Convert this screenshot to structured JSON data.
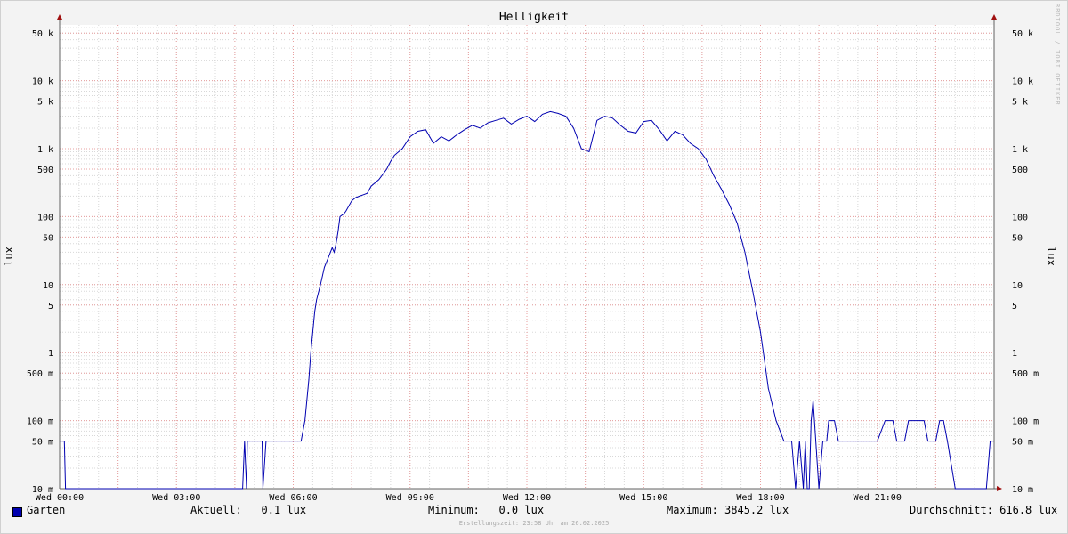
{
  "watermark": "RRDTOOL / TOBI OETIKER",
  "footer": "Erstellungszeit: 23:58 Uhr am 26.02.2025",
  "legend": {
    "series_name": "Garten",
    "current": "Aktuell:   0.1 lux",
    "minimum": "Minimum:   0.0 lux",
    "maximum": "Maximum: 3845.2 lux",
    "average": "Durchschnitt: 616.8 lux"
  },
  "colors": {
    "line": "#0000b0",
    "major_grid": "#e8a0a0",
    "minor_grid": "#d8d8d8",
    "arrow": "#a01010"
  },
  "chart_data": {
    "type": "line",
    "title": "Helligkeit",
    "ylabel": "lux",
    "ylabel_right": "lux",
    "yscale": "log",
    "ylim": [
      10,
      70000
    ],
    "xlim": [
      0,
      24
    ],
    "x_ticks": [
      {
        "v": 0,
        "label": "Wed 00:00"
      },
      {
        "v": 3,
        "label": "Wed 03:00"
      },
      {
        "v": 6,
        "label": "Wed 06:00"
      },
      {
        "v": 9,
        "label": "Wed 09:00"
      },
      {
        "v": 12,
        "label": "Wed 12:00"
      },
      {
        "v": 15,
        "label": "Wed 15:00"
      },
      {
        "v": 18,
        "label": "Wed 18:00"
      },
      {
        "v": 21,
        "label": "Wed 21:00"
      }
    ],
    "y_ticks": [
      {
        "v": 50000,
        "label": "50 k"
      },
      {
        "v": 10000,
        "label": "10 k"
      },
      {
        "v": 5000,
        "label": "5 k"
      },
      {
        "v": 1000,
        "label": "1 k"
      },
      {
        "v": 500,
        "label": "500"
      },
      {
        "v": 100,
        "label": "100"
      },
      {
        "v": 50,
        "label": "50"
      },
      {
        "v": 10,
        "label": "10"
      },
      {
        "v": 5,
        "label": "5"
      },
      {
        "v": 1,
        "label": "1"
      },
      {
        "v": 0.5,
        "label": "500 m"
      },
      {
        "v": 0.1,
        "label": "100 m"
      },
      {
        "v": 0.05,
        "label": "50 m"
      },
      {
        "v": 0.01,
        "label": "10 m"
      }
    ],
    "series": [
      {
        "name": "Garten",
        "x": [
          0.0,
          0.12,
          0.15,
          0.17,
          1.0,
          2.0,
          3.0,
          4.7,
          4.75,
          4.8,
          4.82,
          4.85,
          5.0,
          5.2,
          5.22,
          5.3,
          5.33,
          5.5,
          5.7,
          6.0,
          6.2,
          6.3,
          6.35,
          6.4,
          6.45,
          6.5,
          6.55,
          6.6,
          6.7,
          6.8,
          6.9,
          7.0,
          7.05,
          7.1,
          7.15,
          7.2,
          7.3,
          7.35,
          7.5,
          7.6,
          7.7,
          7.8,
          7.9,
          8.0,
          8.2,
          8.4,
          8.5,
          8.6,
          8.8,
          9.0,
          9.2,
          9.4,
          9.6,
          9.8,
          10.0,
          10.2,
          10.4,
          10.6,
          10.8,
          11.0,
          11.2,
          11.4,
          11.6,
          11.8,
          12.0,
          12.2,
          12.4,
          12.6,
          12.8,
          13.0,
          13.2,
          13.4,
          13.6,
          13.8,
          14.0,
          14.2,
          14.4,
          14.6,
          14.8,
          15.0,
          15.2,
          15.4,
          15.6,
          15.8,
          16.0,
          16.2,
          16.4,
          16.6,
          16.8,
          17.0,
          17.2,
          17.4,
          17.6,
          17.8,
          18.0,
          18.2,
          18.4,
          18.6,
          18.8,
          18.9,
          19.0,
          19.1,
          19.15,
          19.2,
          19.25,
          19.3,
          19.35,
          19.5,
          19.6,
          19.7,
          19.75,
          19.8,
          19.9,
          20.0,
          20.1,
          20.2,
          20.3,
          20.4,
          20.5,
          20.6,
          20.8,
          21.0,
          21.2,
          21.4,
          21.5,
          21.6,
          21.7,
          21.8,
          22.0,
          22.2,
          22.3,
          22.5,
          22.6,
          22.7,
          22.8,
          23.0,
          23.5,
          23.8,
          23.9,
          24.0
        ],
        "y": [
          0.05,
          0.05,
          0.01,
          0.01,
          0.01,
          0.01,
          0.01,
          0.01,
          0.05,
          0.01,
          0.05,
          0.05,
          0.05,
          0.05,
          0.01,
          0.05,
          0.05,
          0.05,
          0.05,
          0.05,
          0.05,
          0.1,
          0.2,
          0.4,
          1.0,
          2.0,
          4.0,
          6.0,
          10,
          18,
          25,
          35,
          30,
          40,
          60,
          100,
          110,
          120,
          170,
          190,
          200,
          210,
          220,
          280,
          350,
          500,
          650,
          800,
          1000,
          1500,
          1800,
          1900,
          1200,
          1500,
          1300,
          1600,
          1900,
          2200,
          2000,
          2400,
          2600,
          2800,
          2300,
          2700,
          3000,
          2500,
          3200,
          3500,
          3300,
          3000,
          2000,
          1000,
          900,
          2600,
          3000,
          2800,
          2200,
          1800,
          1700,
          2500,
          2600,
          1900,
          1300,
          1800,
          1600,
          1200,
          1000,
          700,
          400,
          250,
          150,
          80,
          30,
          8,
          2,
          0.3,
          0.1,
          0.05,
          0.05,
          0.01,
          0.05,
          0.01,
          0.05,
          0.01,
          0.01,
          0.1,
          0.2,
          0.01,
          0.05,
          0.05,
          0.1,
          0.1,
          0.1,
          0.05,
          0.05,
          0.05,
          0.05,
          0.05,
          0.05,
          0.05,
          0.05,
          0.05,
          0.1,
          0.1,
          0.05,
          0.05,
          0.05,
          0.1,
          0.1,
          0.1,
          0.05,
          0.05,
          0.1,
          0.1,
          0.05,
          0.01,
          0.01,
          0.01,
          0.05,
          0.05
        ]
      }
    ]
  }
}
